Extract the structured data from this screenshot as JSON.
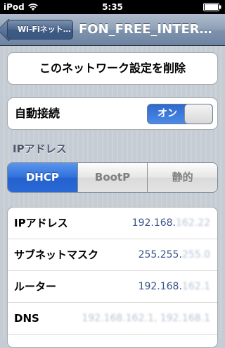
{
  "status": {
    "carrier": "iPod",
    "time": "5:35"
  },
  "nav": {
    "back_label": "Wi-Fiネット…",
    "title": "FON_FREE_INTER…"
  },
  "forget_button": "このネットワーク設定を削除",
  "auto_join": {
    "label": "自動接続",
    "state": "オン"
  },
  "ip_section_header": "IPアドレス",
  "segments": {
    "dhcp": "DHCP",
    "bootp": "BootP",
    "static": "静的",
    "selected": "DHCP"
  },
  "info": {
    "ip": {
      "label": "IPアドレス",
      "value": "192.168.",
      "masked": "162.22"
    },
    "subnet": {
      "label": "サブネットマスク",
      "value": "255.255.",
      "masked": "255.0"
    },
    "router": {
      "label": "ルーター",
      "value": "192.168.",
      "masked": "162.1"
    },
    "dns": {
      "label": "DNS",
      "value": "",
      "masked": "192.168.162.1, 192.168.1"
    }
  },
  "colors": {
    "accent": "#2f70d9",
    "value_text": "#385487",
    "nav": "#6d84a2"
  }
}
